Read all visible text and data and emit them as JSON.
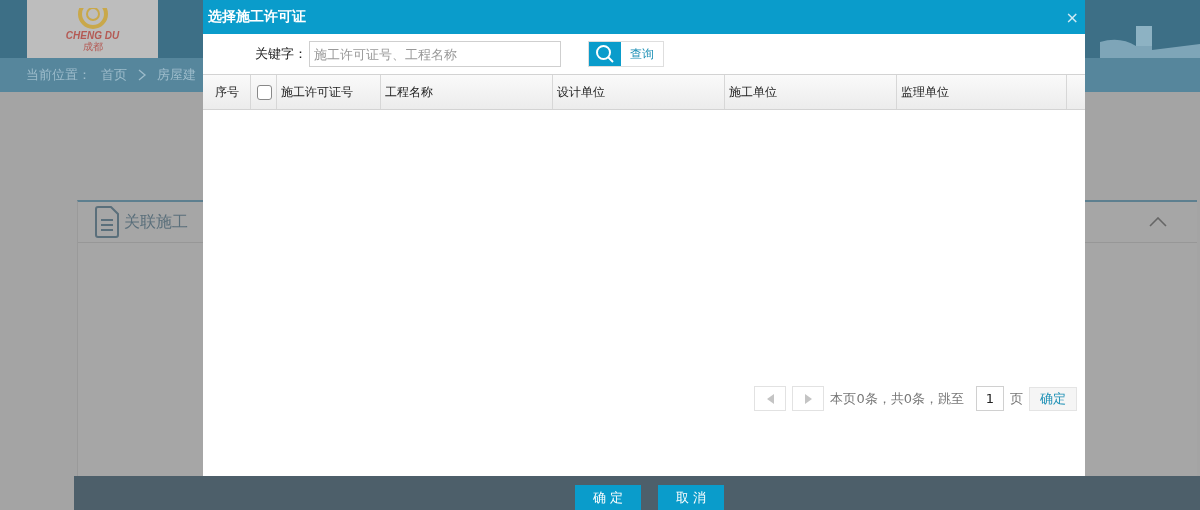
{
  "background": {
    "logo": {
      "text": "CHENG DU",
      "subtext": "成都"
    },
    "breadcrumb": {
      "label": "当前位置：",
      "items": [
        "首页",
        "房屋建"
      ]
    },
    "panel": {
      "title": "关联施工"
    }
  },
  "dialog": {
    "title": "选择施工许可证",
    "close": "×",
    "search": {
      "label": "关键字：",
      "placeholder": "施工许可证号、工程名称",
      "button": "查询"
    },
    "table": {
      "select_all": {
        "checked": false
      },
      "columns": [
        "序号",
        "施工许可证号",
        "工程名称",
        "设计单位",
        "施工单位",
        "监理单位"
      ]
    },
    "pager": {
      "prev": {
        "disabled": true
      },
      "next": {
        "disabled": true
      },
      "summary": "本页0条，共0条，跳至",
      "page": "1",
      "unit": "页",
      "go": "确定"
    },
    "buttons": [
      "确 定",
      "取 消"
    ]
  }
}
